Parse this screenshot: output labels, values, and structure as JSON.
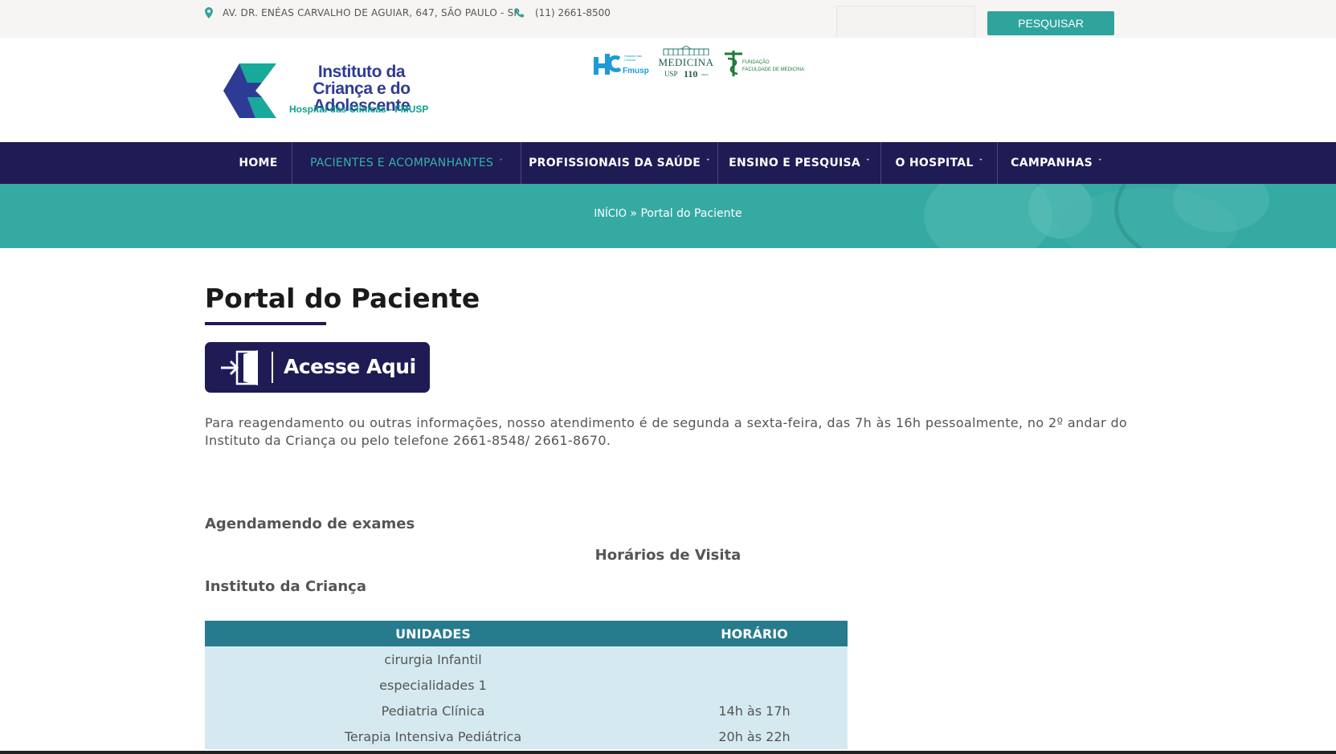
{
  "topbar": {
    "address": "AV. DR. ENÉAS CARVALHO DE AGUIAR, 647, SÃO PAULO - SP",
    "phone": "(11) 2661-8500",
    "search_placeholder": "",
    "search_button": "PESQUISAR",
    "icons": [
      "map-pin-icon",
      "phone-icon"
    ],
    "accent_color": "#2fa49c"
  },
  "header": {
    "logo_title": "Instituto da Criança e do Adolescente",
    "logo_subtitle": "Hospital das Clínicas - FMUSP",
    "partners": {
      "hc_caption": "Hospital das Clínicas",
      "hc_name": "Fmusp",
      "medicina": "MEDICINA",
      "medicina_sub": "USP",
      "medicina_years": "110",
      "medicina_years_unit": "ANOS",
      "fundacao_line1": "FUNDAÇÃO",
      "fundacao_line2": "FACULDADE DE MEDICINA"
    }
  },
  "nav": {
    "background": "#1f1b55",
    "items": [
      {
        "label": "HOME",
        "dropdown": false,
        "active": false
      },
      {
        "label": "PACIENTES E ACOMPANHANTES",
        "dropdown": true,
        "active": true
      },
      {
        "label": "PROFISSIONAIS DA SAÚDE",
        "dropdown": true,
        "active": false
      },
      {
        "label": "ENSINO E PESQUISA",
        "dropdown": true,
        "active": false
      },
      {
        "label": "O HOSPITAL",
        "dropdown": true,
        "active": false
      },
      {
        "label": "CAMPANHAS",
        "dropdown": true,
        "active": false
      }
    ]
  },
  "breadcrumb": {
    "home": "INÍCIO",
    "separator": "»",
    "current": "Portal do Paciente"
  },
  "main": {
    "title": "Portal do Paciente",
    "access_button": "Acesse Aqui",
    "info_text": "Para reagendamento ou outras informações, nosso atendimento é de segunda a sexta-feira, das 7h às 16h pessoalmente, no 2º andar do Instituto da Criança ou pelo telefone 2661-8548/ 2661-8670.",
    "exames_heading": "Agendamendo de exames",
    "visita_heading": "Horários de Visita",
    "instituto_heading": "Instituto da Criança",
    "table": {
      "headers": [
        "UNIDADES",
        "HORÁRIO"
      ],
      "rows": [
        [
          "cirurgia Infantil",
          ""
        ],
        [
          "especialidades 1",
          ""
        ],
        [
          "Pediatria Clínica",
          "14h às 17h"
        ],
        [
          "Terapia Intensiva Pediátrica",
          "20h às 22h"
        ]
      ]
    }
  }
}
